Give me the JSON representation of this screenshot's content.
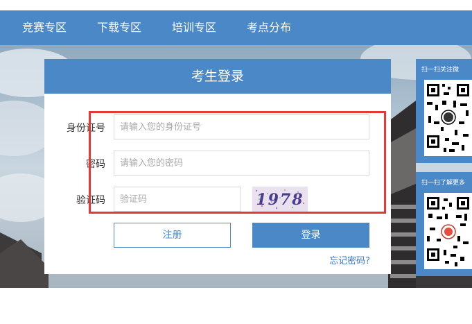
{
  "nav": {
    "items": [
      {
        "label": "竞赛专区"
      },
      {
        "label": "下载专区"
      },
      {
        "label": "培训专区"
      },
      {
        "label": "考点分布"
      }
    ]
  },
  "login": {
    "title": "考生登录",
    "id_label": "身份证号",
    "id_placeholder": "请输入您的身份证号",
    "password_label": "密码",
    "password_placeholder": "请输入您的密码",
    "captcha_label": "验证码",
    "captcha_placeholder": "验证码",
    "captcha_text": "1978",
    "register_label": "注册",
    "login_label": "登录",
    "forgot_label": "忘记密码?"
  },
  "side": {
    "qr1_caption": "扫一扫关注微",
    "qr2_caption": "扫一扫了解更多"
  },
  "colors": {
    "accent": "#4a88c8",
    "highlight": "#e53935"
  }
}
